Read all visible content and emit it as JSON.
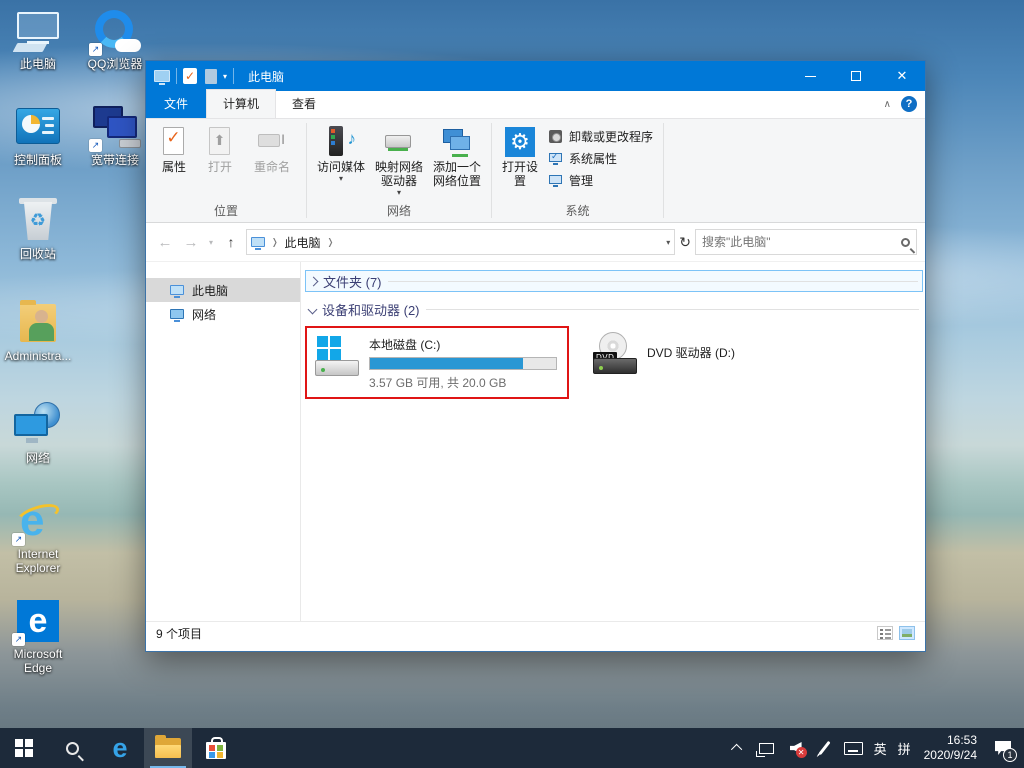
{
  "colors": {
    "accent": "#0078d7",
    "highlight_red": "#e01515",
    "usage_fill": "#2997d4",
    "taskbar_bg": "#1d2a3a"
  },
  "desktop": {
    "icons": [
      {
        "label": "此电脑",
        "icon": "this-pc"
      },
      {
        "label": "QQ浏览器",
        "icon": "qq-browser"
      },
      {
        "label": "控制面板",
        "icon": "control-panel"
      },
      {
        "label": "宽带连接",
        "icon": "broadband-connection"
      },
      {
        "label": "回收站",
        "icon": "recycle-bin"
      },
      {
        "label": "Administra...",
        "icon": "user-folder"
      },
      {
        "label": "网络",
        "icon": "network"
      },
      {
        "label": "Internet Explorer",
        "icon": "internet-explorer"
      },
      {
        "label": "Microsoft Edge",
        "icon": "microsoft-edge"
      }
    ]
  },
  "window": {
    "title": "此电脑",
    "tabs": {
      "file": "文件",
      "computer": "计算机",
      "view": "查看"
    },
    "ribbon": {
      "location_group": {
        "label": "位置",
        "properties": "属性",
        "open": "打开",
        "rename": "重命名"
      },
      "network_group": {
        "label": "网络",
        "access_media": "访问媒体",
        "map_drive": "映射网络驱动器",
        "add_location": "添加一个网络位置"
      },
      "system_group": {
        "label": "系统",
        "open_settings": "打开设置",
        "uninstall": "卸载或更改程序",
        "sys_props": "系统属性",
        "manage": "管理"
      },
      "help": "?"
    },
    "address": {
      "breadcrumb": "此电脑",
      "search_placeholder": "搜索\"此电脑\""
    },
    "nav": {
      "this_pc": "此电脑",
      "network": "网络"
    },
    "groups": {
      "folders": "文件夹 (7)",
      "devices": "设备和驱动器 (2)"
    },
    "drives": {
      "c": {
        "name": "本地磁盘 (C:)",
        "detail": "3.57 GB 可用, 共 20.0 GB",
        "usage_percent": 82
      },
      "d": {
        "name": "DVD 驱动器 (D:)"
      }
    },
    "status": {
      "items": "9 个项目"
    }
  },
  "taskbar": {
    "tray": {
      "lang_en": "英",
      "lang_pinyin": "拼",
      "time": "16:53",
      "date": "2020/9/24",
      "notification_count": "1"
    }
  }
}
